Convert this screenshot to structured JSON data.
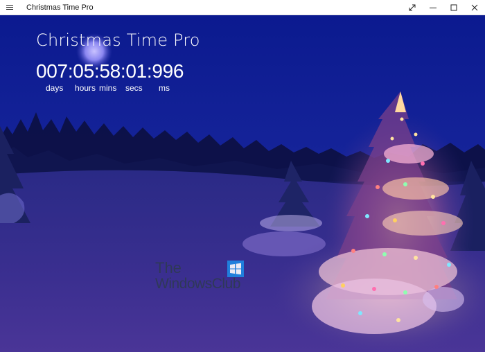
{
  "window": {
    "title": "Christmas Time Pro"
  },
  "icons": {
    "menu": "hamburger-menu-icon",
    "fullscreen": "expand-arrows-icon",
    "minimize": "minimize-icon",
    "maximize": "maximize-icon",
    "close": "close-icon"
  },
  "app": {
    "heading": "Christmas Time Pro",
    "countdown": {
      "value": "007:05:58:01:996",
      "units": [
        "days",
        "hours",
        "mins",
        "secs",
        "ms"
      ]
    }
  },
  "watermark": {
    "line1": "The",
    "line2": "WindowsClub"
  },
  "colors": {
    "sky_top": "#0b1a8a",
    "sky_bottom": "#1f2a7a",
    "snow": "#3a2a8a",
    "text": "#ffffff",
    "watermark": "#2e3a52",
    "watermark_logo": "#1e88e5"
  }
}
